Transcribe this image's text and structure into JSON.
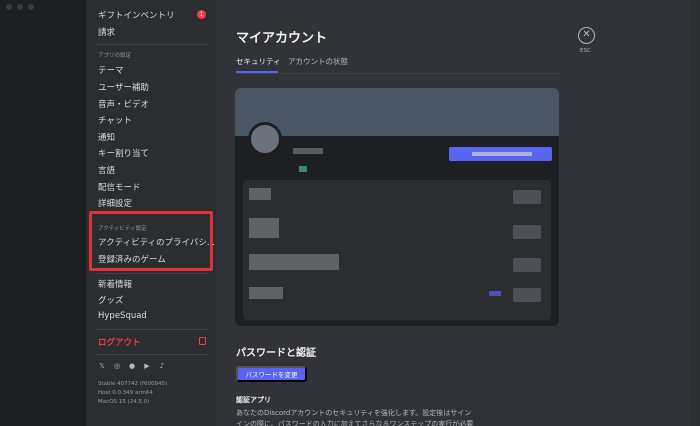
{
  "sidebar": {
    "top_items": [
      {
        "label": "ギフトインベントリ",
        "badge": "1"
      },
      {
        "label": "請求"
      }
    ],
    "app_settings": {
      "header": "アプリの設定",
      "items": [
        "テーマ",
        "ユーザー補助",
        "音声・ビデオ",
        "チャット",
        "通知",
        "キー割り当て",
        "言語",
        "配信モード",
        "詳細設定"
      ]
    },
    "activity_settings": {
      "header": "アクティビティ設定",
      "items": [
        "アクティビティのプライバシ...",
        "登録済みのゲーム"
      ]
    },
    "misc_items": [
      "新着情報",
      "グッズ",
      "HypeSquad"
    ],
    "logout_label": "ログアウト",
    "social_icons": [
      "x-icon",
      "instagram-icon",
      "facebook-icon",
      "youtube-icon",
      "tiktok-icon"
    ],
    "version_lines": [
      "Stable 407742 (f600845)",
      "Host 0.0.349 arm64",
      "MacOS 15 (24.5.0)"
    ]
  },
  "main": {
    "title": "マイアカウント",
    "tabs": [
      "セキュリティ",
      "アカウントの状態"
    ],
    "active_tab": "セキュリティ",
    "password_section": {
      "title": "パスワードと認証",
      "change_button": "パスワードを変更",
      "auth_app_title": "認証アプリ",
      "description": "あなたのDiscordアカウントのセキュリティを強化します。設定後はサインインの際に、パスワードの入力に加えてさらなるワンステップの実行が必要にな"
    },
    "close": {
      "label": "ESC",
      "icon": "close-icon"
    }
  },
  "colors": {
    "accent": "#5865f2",
    "danger": "#f23f43",
    "highlight_box": "#e0303a",
    "background": "#313338",
    "sidebar": "#2b2d31"
  }
}
